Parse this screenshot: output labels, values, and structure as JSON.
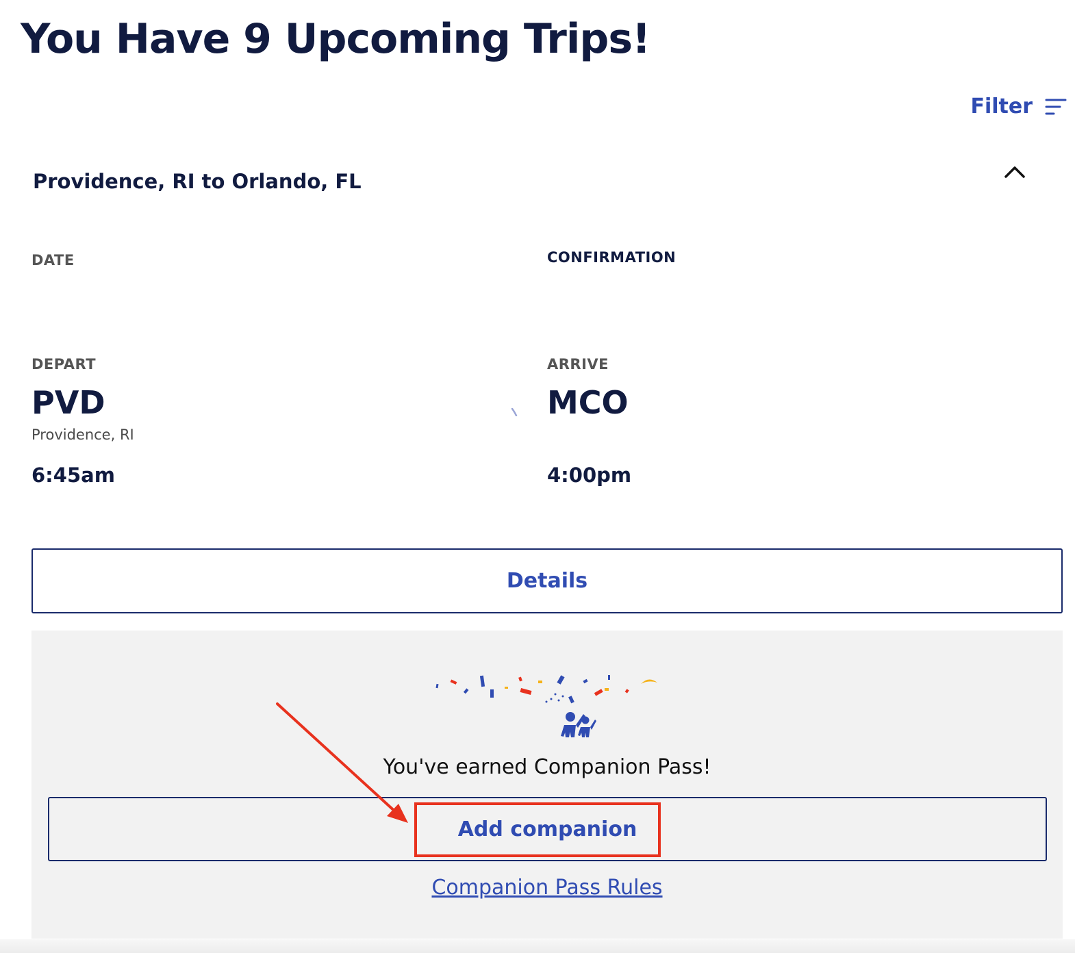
{
  "header": {
    "title": "You Have 9 Upcoming Trips!",
    "filter_label": "Filter",
    "filter_icon": "filter-lines-icon"
  },
  "trip": {
    "route": "Providence, RI to Orlando, FL",
    "collapse_icon": "chevron-up-icon",
    "date_label": "DATE",
    "confirmation_label": "CONFIRMATION",
    "depart": {
      "label": "DEPART",
      "code": "PVD",
      "city": "Providence, RI",
      "time": "6:45am"
    },
    "arrive": {
      "label": "ARRIVE",
      "code": "MCO",
      "time": "4:00pm"
    },
    "details_label": "Details"
  },
  "companion": {
    "illustration_icon": "celebration-confetti-icon",
    "earned_text": "You've earned Companion Pass!",
    "add_label": "Add companion",
    "rules_link": "Companion Pass Rules"
  },
  "colors": {
    "heading": "#111b40",
    "accent_blue": "#304cb2",
    "border_navy": "#1a2b6b",
    "panel_bg": "#f2f2f2",
    "annotation_red": "#e8321e"
  }
}
